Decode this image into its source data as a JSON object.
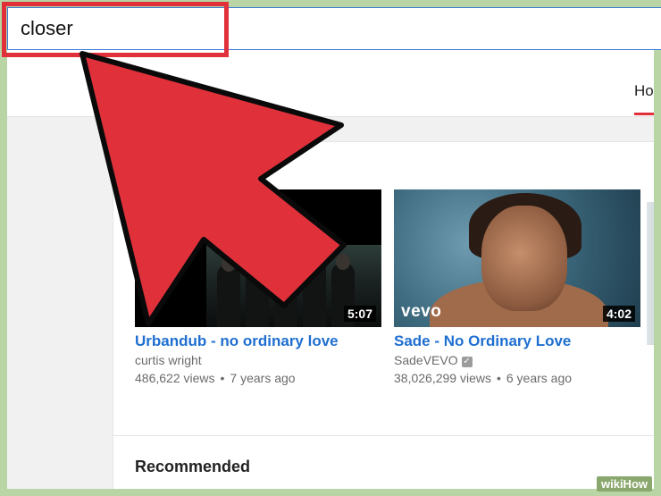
{
  "search": {
    "value": "closer"
  },
  "nav": {
    "home_tab": "Ho"
  },
  "videos": [
    {
      "title": "Urbandub - no ordinary love",
      "channel": "curtis wright",
      "views": "486,622 views",
      "age": "7 years ago",
      "duration": "5:07"
    },
    {
      "title": "Sade - No Ordinary Love",
      "channel": "SadeVEVO",
      "views": "38,026,299 views",
      "age": "6 years ago",
      "duration": "4:02",
      "brand": "vevo"
    }
  ],
  "sections": {
    "recommended": "Recommended"
  },
  "watermark": "wikiHow",
  "colors": {
    "accent_red": "#e0313b",
    "link_blue": "#1f6fd1",
    "frame_green": "#b9d5a5"
  }
}
